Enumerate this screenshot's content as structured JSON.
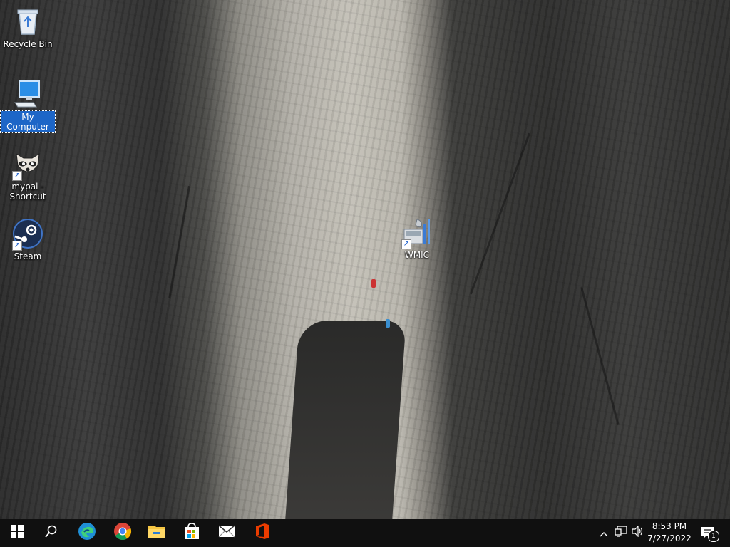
{
  "desktop": {
    "icons": [
      {
        "label": "Recycle Bin",
        "icon": "recycle-bin-icon"
      },
      {
        "label": "My Computer",
        "icon": "computer-icon",
        "selected": true
      },
      {
        "label_line1": "mypal -",
        "label_line2": "Shortcut",
        "icon": "mypal-raccoon-icon",
        "shortcut": true
      },
      {
        "label": "Steam",
        "icon": "steam-icon",
        "shortcut": true
      },
      {
        "label": "WMIC",
        "icon": "wmic-icon",
        "shortcut": true
      }
    ]
  },
  "taskbar": {
    "start_icon": "windows-logo-icon",
    "search_icon": "search-icon",
    "pinned": [
      "edge-icon",
      "chrome-icon",
      "file-explorer-icon",
      "microsoft-store-icon",
      "mail-icon",
      "office-icon"
    ],
    "tray": {
      "chevron_icon": "chevron-up-icon",
      "network_icon": "network-icon",
      "volume_icon": "volume-icon",
      "time": "8:53 PM",
      "date": "7/27/2022",
      "notification_count": "1"
    }
  },
  "colors": {
    "taskbar_bg": "#101010",
    "selection_blue": "#1d66c7"
  }
}
